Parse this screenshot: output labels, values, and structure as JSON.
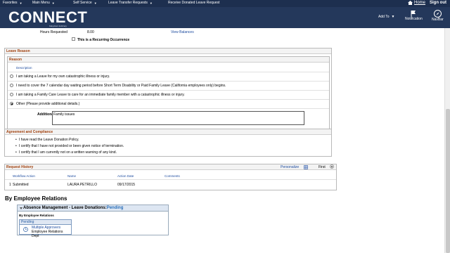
{
  "menubar": {
    "items": [
      "Favorites",
      "Main Menu",
      "Self Service",
      "Leave Transfer Requests",
      "Receive Donated Leave Request"
    ],
    "home": "Home",
    "signout": "Sign out"
  },
  "header": {
    "logo": "CONNECT",
    "logo_sub": "Maryland Judiciary",
    "add_to": "Add To",
    "notification": "Notification",
    "navbar": "NavBar"
  },
  "hours": {
    "label": "Hours Requested",
    "value": "8.00",
    "view_balances": "View Balances",
    "recurring": "This is a Recurring Occurrence"
  },
  "leave_reason": {
    "title": "Leave Reason",
    "reason_title": "Reason",
    "description_header": "Description",
    "options": [
      "I am taking a Leave for my own catastrophic illness or injury.",
      "I need to cover the 7 calendar day waiting period before Short Term Disability or Paid Family Leave (California employees only) begins.",
      "I am taking a Family Care Leave to care for an immediate family member with a catastrophic illness or injury.",
      "Other (Please provide additional details.)"
    ],
    "selected_index": 3,
    "additional_details_label": "Additional Details",
    "additional_details_value": "Family issues"
  },
  "agreement": {
    "title": "Agreement and Compliance",
    "items": [
      "I have read the Leave Donation Policy.",
      "I certify that I have not provided or been given notice of termination.",
      "I certify that I am currently not on a written warning of any kind."
    ]
  },
  "history": {
    "title": "Request History",
    "personalize": "Personalize",
    "first": "First",
    "columns": [
      "Workflow Action",
      "Name",
      "Action Date",
      "Comments"
    ],
    "rows": [
      {
        "num": "1",
        "action": "Submitted",
        "name": "LAURA PETRILLO",
        "date": "09/17/2015",
        "comments": ""
      }
    ]
  },
  "relations": {
    "title": "By Employee Relations",
    "panel_title": "Absence Management - Leave Donations:",
    "panel_status": "Pending",
    "sub_title": "By Employee Relations",
    "pending_label": "Pending",
    "approvers_link": "Multiple Approvers",
    "approvers_dept": "Employee Relations Dept"
  },
  "colors": {
    "menubar": "#1d2f4f",
    "header": "#24385b",
    "section_title": "#a0400d",
    "link": "#1b4a9e"
  }
}
